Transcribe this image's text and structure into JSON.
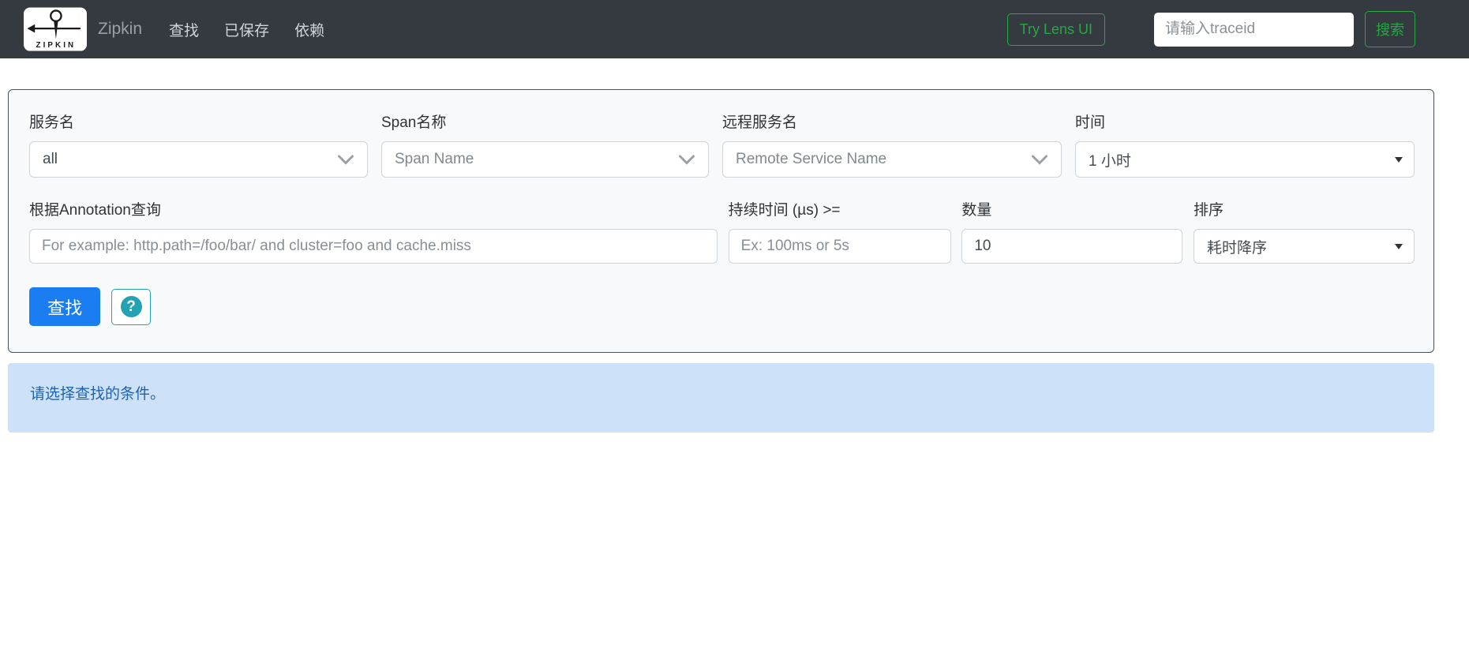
{
  "navbar": {
    "logo_text": "ZIPKIN",
    "brand": "Zipkin",
    "links": [
      {
        "label": "查找"
      },
      {
        "label": "已保存"
      },
      {
        "label": "依赖"
      }
    ],
    "lens_button": "Try Lens UI",
    "trace_input_placeholder": "请输入traceid",
    "search_button": "搜索"
  },
  "search_form": {
    "fields": {
      "service": {
        "label": "服务名",
        "value": "all"
      },
      "span": {
        "label": "Span名称",
        "placeholder": "Span Name"
      },
      "remote": {
        "label": "远程服务名",
        "placeholder": "Remote Service Name"
      },
      "lookback": {
        "label": "时间",
        "value": "1 小时"
      },
      "annotation": {
        "label": "根据Annotation查询",
        "placeholder": "For example: http.path=/foo/bar/ and cluster=foo and cache.miss"
      },
      "duration": {
        "label": "持续时间 (µs) >=",
        "placeholder": "Ex: 100ms or 5s"
      },
      "limit": {
        "label": "数量",
        "value": "10"
      },
      "sort": {
        "label": "排序",
        "value": "耗时降序"
      }
    },
    "find_button": "查找",
    "help_icon": "?"
  },
  "alert": {
    "message": "请选择查找的条件。"
  },
  "colors": {
    "navbar_bg": "#343a40",
    "green": "#28a745",
    "primary_blue": "#1a7df2",
    "help_teal": "#22a2b3",
    "alert_bg": "#cde2f8",
    "alert_text": "#1e62b0"
  }
}
